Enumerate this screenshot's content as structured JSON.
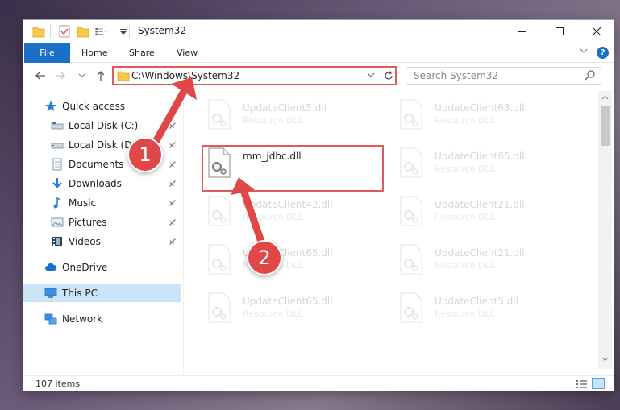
{
  "window": {
    "title": "System32",
    "controls": {
      "minimize": "—",
      "maximize": "☐",
      "close": "✕"
    }
  },
  "ribbon": {
    "file": "File",
    "tabs": [
      "Home",
      "Share",
      "View"
    ],
    "help": "?"
  },
  "navbar": {
    "address": "C:\\Windows\\System32",
    "search_placeholder": "Search System32"
  },
  "sidebar": {
    "items": [
      {
        "label": "Quick access",
        "icon": "star-icon"
      },
      {
        "label": "Local Disk (C:)",
        "icon": "drive-icon",
        "pinned": true
      },
      {
        "label": "Local Disk (D:)",
        "icon": "drive-icon",
        "pinned": true
      },
      {
        "label": "Documents",
        "icon": "document-icon",
        "pinned": true
      },
      {
        "label": "Downloads",
        "icon": "download-icon",
        "pinned": true
      },
      {
        "label": "Music",
        "icon": "music-icon",
        "pinned": true
      },
      {
        "label": "Pictures",
        "icon": "picture-icon",
        "pinned": true
      },
      {
        "label": "Videos",
        "icon": "video-icon",
        "pinned": true
      },
      {
        "label": "OneDrive",
        "icon": "cloud-icon"
      },
      {
        "label": "This PC",
        "icon": "computer-icon",
        "selected": true
      },
      {
        "label": "Network",
        "icon": "network-icon"
      }
    ]
  },
  "files": {
    "left": [
      {
        "name": "UpdateClient5.dll",
        "type": "Resource DLL",
        "faded": true
      },
      {
        "name": "mm_jdbc.dll",
        "type": "",
        "faded": false
      },
      {
        "name": "UpdateClient42.dll",
        "type": "Resource DLL",
        "faded": true
      },
      {
        "name": "UpdateClient65.dll",
        "type": "Resource DLL",
        "faded": true
      },
      {
        "name": "UpdateClient65.dll",
        "type": "Resource DLL",
        "faded": true
      }
    ],
    "right": [
      {
        "name": "UpdateClient63.dll",
        "type": "Resource DLL",
        "faded": true
      },
      {
        "name": "UpdateClient65.dll",
        "type": "Resource DLL",
        "faded": true
      },
      {
        "name": "UpdateClient21.dll",
        "type": "Resource DLL",
        "faded": true
      },
      {
        "name": "UpdateClient21.dll",
        "type": "Resource DLL",
        "faded": true
      },
      {
        "name": "UpdateClient5.dll",
        "type": "Resource DLL",
        "faded": true
      }
    ]
  },
  "status": {
    "count": "107 items"
  },
  "annotations": {
    "step1": "1",
    "step2": "2"
  },
  "colors": {
    "accent": "#1a6fc7",
    "highlight": "#e05a5a",
    "badge": "#e04848",
    "selected": "#cce4f7"
  }
}
